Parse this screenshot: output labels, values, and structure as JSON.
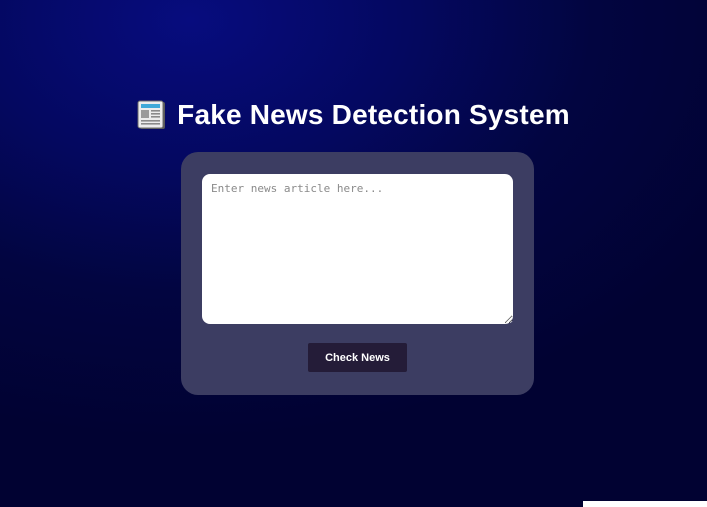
{
  "header": {
    "icon": "newspaper-icon",
    "title": "Fake News Detection System"
  },
  "form": {
    "placeholder": "Enter news article here...",
    "value": "",
    "button_label": "Check News"
  },
  "colors": {
    "background": "#030660",
    "card": "#3c3d62",
    "button": "#241c38",
    "title_text": "#ffffff"
  }
}
